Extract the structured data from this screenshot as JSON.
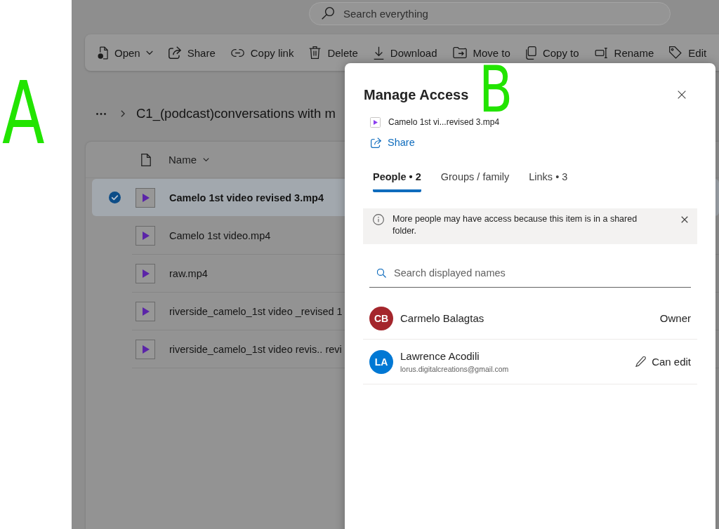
{
  "annotations": [
    {
      "label": "A"
    },
    {
      "label": "B"
    }
  ],
  "search": {
    "placeholder": "Search everything"
  },
  "command_bar": [
    {
      "label": "Open",
      "kind": "menu"
    },
    {
      "label": "Share",
      "kind": "button"
    },
    {
      "label": "Copy link",
      "kind": "button"
    },
    {
      "label": "Delete",
      "kind": "button"
    },
    {
      "label": "Download",
      "kind": "button"
    },
    {
      "label": "Move to",
      "kind": "button"
    },
    {
      "label": "Copy to",
      "kind": "button"
    },
    {
      "label": "Rename",
      "kind": "button"
    },
    {
      "label": "Edit",
      "kind": "button"
    }
  ],
  "breadcrumb": {
    "current": "C1_(podcast)conversations with m"
  },
  "file_list": {
    "columns": [
      {
        "label": "Name"
      }
    ],
    "rows": [
      {
        "name": "Camelo 1st video revised 3.mp4",
        "selected": true
      },
      {
        "name": "Camelo 1st video.mp4",
        "selected": false
      },
      {
        "name": "raw.mp4",
        "selected": false
      },
      {
        "name": "riverside_camelo_1st video _revised 1",
        "selected": false
      },
      {
        "name": "riverside_camelo_1st video revis.. revi",
        "selected": false
      }
    ]
  },
  "dialog": {
    "title": "Manage Access",
    "file_name": "Camelo 1st vi...revised 3.mp4",
    "share_link": "Share",
    "tabs": [
      {
        "label": "People • 2",
        "selected": true
      },
      {
        "label": "Groups / family",
        "selected": false
      },
      {
        "label": "Links • 3",
        "selected": false
      }
    ],
    "notice": "More people may have access because this item is in a shared folder.",
    "search": {
      "placeholder": "Search displayed names"
    },
    "people": [
      {
        "initials": "CB",
        "name": "Carmelo Balagtas",
        "color": "#a4262c",
        "kind": "owner",
        "role": "Owner"
      },
      {
        "initials": "LA",
        "name": "Lawrence Acodili",
        "email": "lorus.digitalcreations@gmail.com",
        "color": "#0078d4",
        "kind": "editor",
        "role": "Can edit"
      }
    ]
  }
}
